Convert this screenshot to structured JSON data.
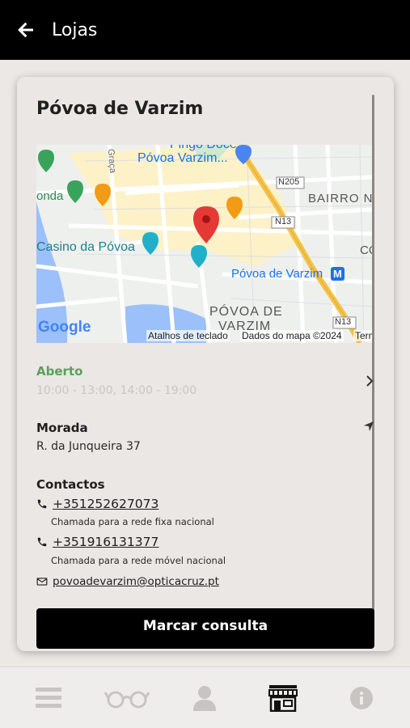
{
  "header": {
    "title": "Lojas"
  },
  "store": {
    "name": "Póvoa de Varzim",
    "map": {
      "labels": {
        "pingo_doce": "Pingo Doce",
        "povoa_varzim_top": "Póvoa Varzim...",
        "graca": "Graça",
        "onda": "onda",
        "n205": "N205",
        "bairro": "BAIRRO N",
        "n13a": "N13",
        "casino": "Casino da Póvoa",
        "co": "CO",
        "metro": "Póvoa de Varzim",
        "povoa_de": "PÓVOA DE",
        "varzim": "VARZIM",
        "n13b": "N13",
        "google": "Google"
      },
      "footer": {
        "shortcuts": "Atalhos de teclado",
        "map_data": "Dados do mapa ©2024",
        "terms": "Term"
      }
    },
    "hours": {
      "status": "Aberto",
      "value": "10:00 - 13:00, 14:00 - 19:00"
    },
    "address": {
      "title": "Morada",
      "value": "R. da Junqueira 37"
    },
    "contacts": {
      "title": "Contactos",
      "phone1": {
        "number": "+351252627073",
        "note": "Chamada para a rede fixa nacional"
      },
      "phone2": {
        "number": "+351916131377",
        "note": "Chamada para a rede móvel nacional"
      },
      "email": "povoadevarzim@opticacruz.pt"
    },
    "book_button": "Marcar consulta"
  },
  "colors": {
    "accent_green": "#5aa15a",
    "header_bg": "#000000",
    "map_pin": "#e53935"
  }
}
